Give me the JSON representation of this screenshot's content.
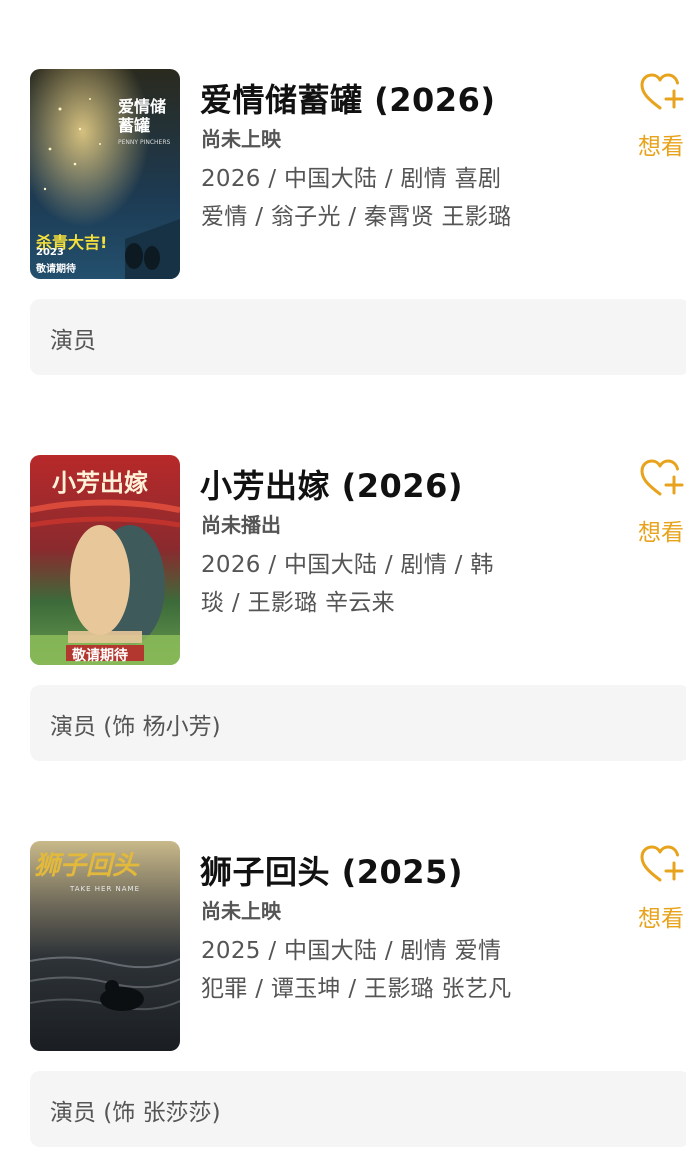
{
  "colors": {
    "accent": "#e8a31c",
    "title": "#111111",
    "meta": "#555555",
    "role_bg": "#f5f5f5"
  },
  "movies": [
    {
      "title": "爱情储蓄罐 (2026)",
      "status": "尚未上映",
      "meta_line1": "2026 / 中国大陆 / 剧情 喜剧",
      "meta_line2": "爱情 / 翁子光 / 秦霄贤 王影璐",
      "want_label": "想看",
      "role": "演员",
      "poster_texts": {
        "title": "爱情储蓄罐",
        "subtitle": "PENNY PINCHERS",
        "tagline": "杀青大吉!",
        "year": "2023",
        "slogan": "敬请期待"
      }
    },
    {
      "title": "小芳出嫁 (2026)",
      "status": "尚未播出",
      "meta_line1": "2026 / 中国大陆 / 剧情 / 韩",
      "meta_line2": "琰 / 王影璐 辛云来",
      "want_label": "想看",
      "role": "演员 (饰 杨小芳)",
      "poster_texts": {
        "title": "小芳出嫁",
        "slogan": "敬请期待"
      }
    },
    {
      "title": "狮子回头 (2025)",
      "status": "尚未上映",
      "meta_line1": "2025 / 中国大陆 / 剧情 爱情",
      "meta_line2": "犯罪 / 谭玉坤 / 王影璐 张艺凡",
      "want_label": "想看",
      "role": "演员 (饰 张莎莎)",
      "poster_texts": {
        "title": "狮子回头",
        "subtitle": "TAKE HER NAME"
      }
    }
  ]
}
